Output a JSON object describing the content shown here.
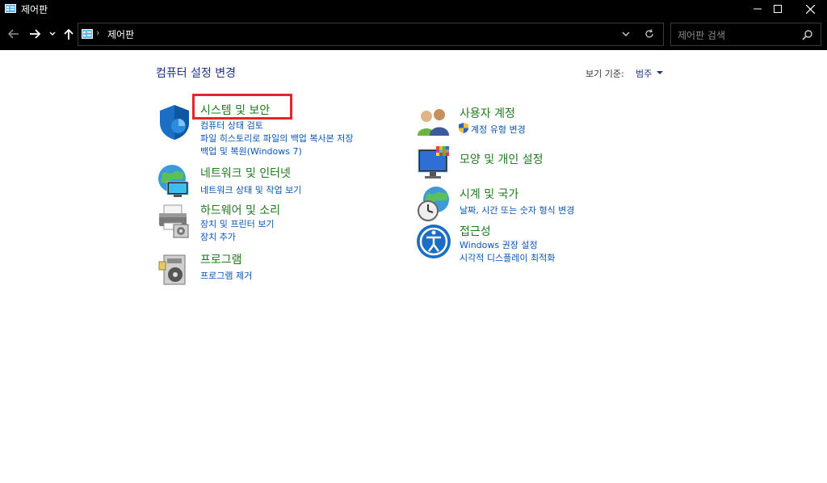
{
  "window": {
    "title": "제어판"
  },
  "address": {
    "crumb": "제어판"
  },
  "search": {
    "placeholder": "제어판 검색"
  },
  "main": {
    "heading": "컴퓨터 설정 변경",
    "view_by_label": "보기 기준:",
    "view_by_value": "범주"
  },
  "categories": [
    {
      "title": "시스템 및 보안",
      "links": [
        "컴퓨터 상태 검토",
        "파일 히스토리로 파일의 백업 복사본 저장",
        "백업 및 복원(Windows 7)"
      ]
    },
    {
      "title": "네트워크 및 인터넷",
      "links": [
        "네트워크 상태 및 작업 보기"
      ]
    },
    {
      "title": "하드웨어 및 소리",
      "links": [
        "장치 및 프린터 보기",
        "장치 추가"
      ]
    },
    {
      "title": "프로그램",
      "links": [
        "프로그램 제거"
      ]
    },
    {
      "title": "사용자 계정",
      "links": [
        "계정 유형 변경"
      ]
    },
    {
      "title": "모양 및 개인 설정",
      "links": []
    },
    {
      "title": "시계 및 국가",
      "links": [
        "날짜, 시간 또는 숫자 형식 변경"
      ]
    },
    {
      "title": "접근성",
      "links": [
        "Windows 권장 설정",
        "시각적 디스플레이 최적화"
      ]
    }
  ],
  "colors": {
    "title_green": "#1f7a1f",
    "link_blue": "#0a56b5",
    "highlight_red": "#e4262a"
  },
  "icons": [
    "control-panel-icon",
    "back-arrow-icon",
    "forward-arrow-icon",
    "recent-dropdown-icon",
    "up-arrow-icon",
    "refresh-icon",
    "search-icon",
    "shield-icon",
    "network-globe-icon",
    "printer-icon",
    "programs-icon",
    "users-icon",
    "display-colors-icon",
    "clock-globe-icon",
    "accessibility-icon",
    "uac-shield-icon"
  ]
}
